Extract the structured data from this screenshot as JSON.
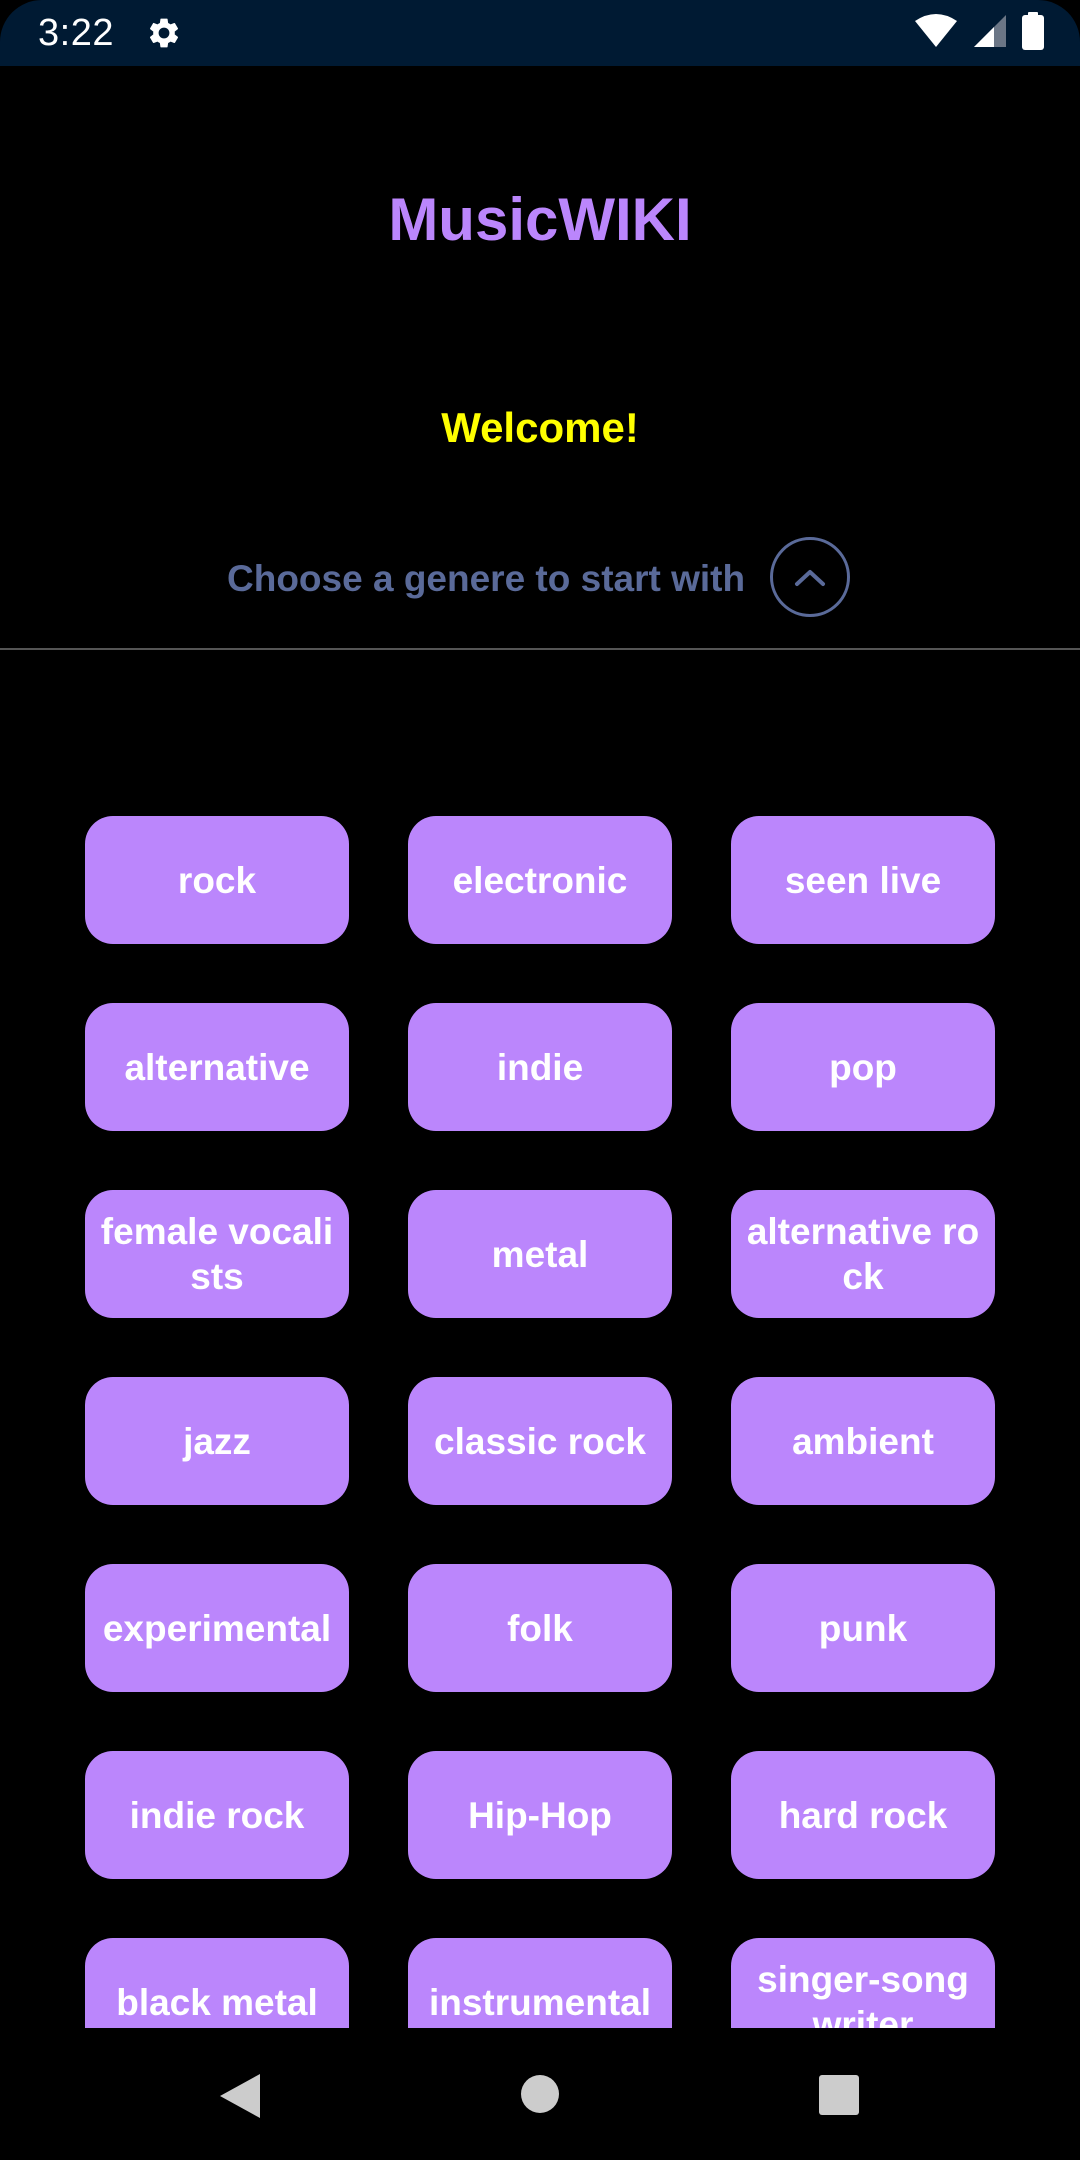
{
  "status_bar": {
    "time": "3:22",
    "icons": [
      "gear-icon",
      "wifi-icon",
      "signal-icon",
      "battery-icon"
    ]
  },
  "header": {
    "title": "MusicWIKI",
    "welcome": "Welcome!",
    "prompt": "Choose a genere to start with",
    "collapse_icon": "chevron-up-icon"
  },
  "genres": [
    "rock",
    "electronic",
    "seen live",
    "alternative",
    "indie",
    "pop",
    "female vocalists",
    "metal",
    "alternative rock",
    "jazz",
    "classic rock",
    "ambient",
    "experimental",
    "folk",
    "punk",
    "indie rock",
    "Hip-Hop",
    "hard rock",
    "black metal",
    "instrumental",
    "singer-songwriter"
  ],
  "nav": {
    "icons": [
      "back-icon",
      "home-icon",
      "recents-icon"
    ]
  },
  "colors": {
    "accent": "#bb86fc",
    "welcome": "#ffff00",
    "prompt": "#5a6a99",
    "status_bar": "#001a33",
    "background": "#000000"
  }
}
